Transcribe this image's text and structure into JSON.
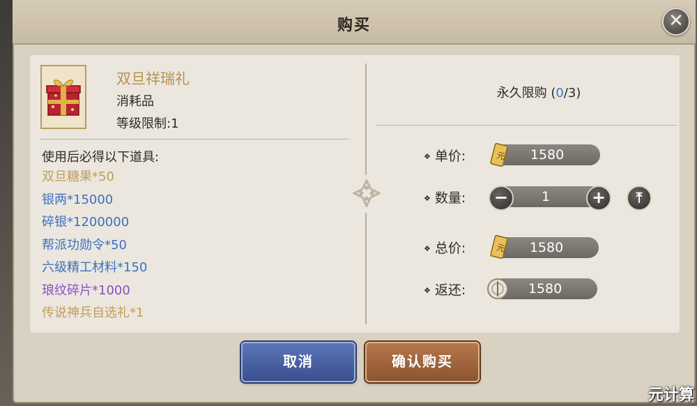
{
  "dialog": {
    "title": "购买"
  },
  "item": {
    "name": "双旦祥瑞礼",
    "type": "消耗品",
    "level_limit": "等级限制:1",
    "icon": "gift-box-icon"
  },
  "rewards": {
    "heading": "使用后必得以下道具:",
    "items": [
      {
        "text": "双旦糖果*50",
        "color": "#c29d58"
      },
      {
        "text": "银两*15000",
        "color": "#3d6fc1"
      },
      {
        "text": "碎银*1200000",
        "color": "#3d6fc1"
      },
      {
        "text": "帮派功勋令*50",
        "color": "#3d6fc1"
      },
      {
        "text": "六级精工材料*150",
        "color": "#3d6fc1"
      },
      {
        "text": "琅纹碎片*1000",
        "color": "#8a4ec4"
      },
      {
        "text": "传说神兵自选礼*1",
        "color": "#c29d58"
      }
    ]
  },
  "purchase": {
    "limit_label": "永久限购",
    "limit_current": "0",
    "limit_max": "3",
    "unit_price_label": "单价:",
    "unit_price_value": "1580",
    "quantity_label": "数量:",
    "quantity_value": "1",
    "total_label": "总价:",
    "total_value": "1580",
    "refund_label": "返还:",
    "refund_value": "1580"
  },
  "buttons": {
    "cancel": "取消",
    "confirm": "确认购买"
  },
  "watermark": "元计算",
  "colors": {
    "gold_text": "#c29d58",
    "blue_text": "#3d6fc1",
    "purple_text": "#8a4ec4",
    "limit_current": "#3c79c9"
  }
}
